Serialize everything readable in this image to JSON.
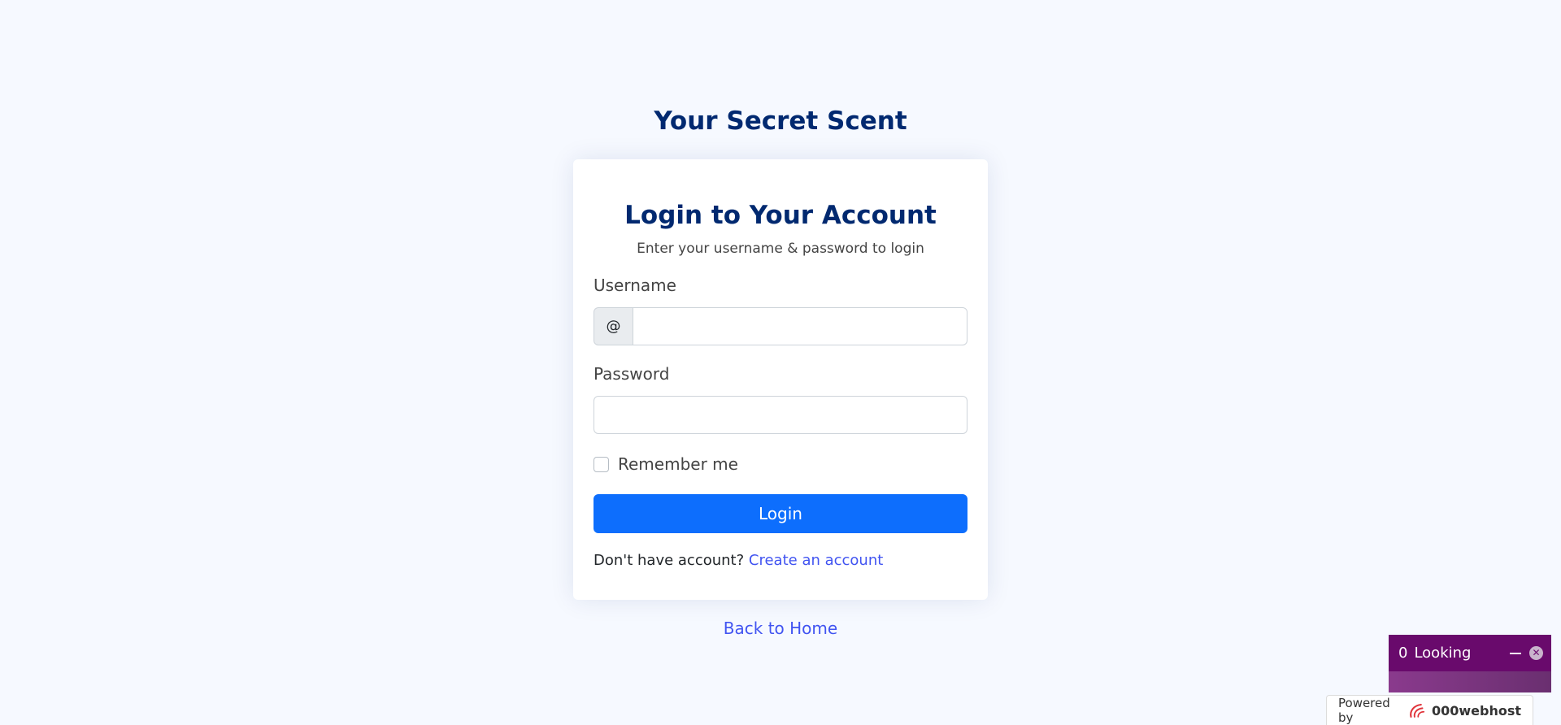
{
  "site": {
    "brand": "Your Secret Scent"
  },
  "login_card": {
    "title": "Login to Your Account",
    "subtitle": "Enter your username & password to login",
    "username_label": "Username",
    "username_prefix": "@",
    "username_value": "",
    "password_label": "Password",
    "password_value": "",
    "remember_label": "Remember me",
    "remember_checked": false,
    "login_button": "Login",
    "register_prompt": "Don't have account?",
    "register_link": "Create an account"
  },
  "footer": {
    "back_home": "Back to Home"
  },
  "widget": {
    "count": "0",
    "label": "Looking",
    "minimize_icon": "minus-icon",
    "close_icon": "close-icon"
  },
  "powered_by": {
    "label": "Powered by",
    "host_name": "000webhost",
    "logo_icon": "000webhost-logo-icon"
  },
  "colors": {
    "brand": "#012970",
    "primary_button": "#0d6efd",
    "link": "#4154f1",
    "widget": "#690a6c",
    "background": "#f6f9ff"
  }
}
